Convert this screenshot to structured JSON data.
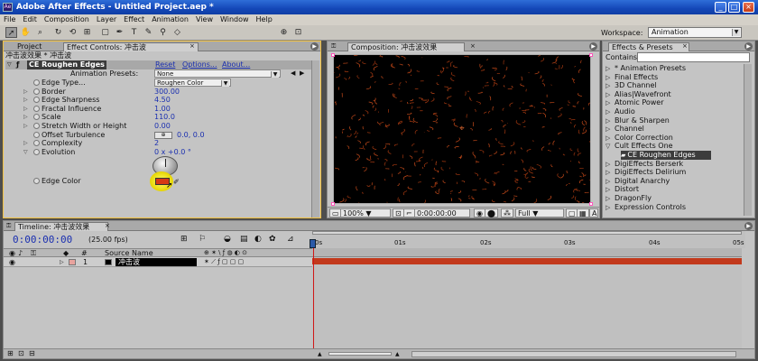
{
  "window": {
    "title": "Adobe After Effects - Untitled Project.aep *",
    "app_icon": "Ae",
    "minimize": "_",
    "maximize": "□",
    "close": "×"
  },
  "menu": [
    "File",
    "Edit",
    "Composition",
    "Layer",
    "Effect",
    "Animation",
    "View",
    "Window",
    "Help"
  ],
  "toolbar": {
    "workspace_label": "Workspace:",
    "workspace_value": "Animation",
    "tools": [
      "selection-arrow",
      "hand",
      "zoom",
      "rotate",
      "camera-orbit",
      "pan-behind",
      "rectangle-mask",
      "pen",
      "type",
      "brush",
      "clone-stamp",
      "eraser",
      "axis-world",
      "axis-view"
    ]
  },
  "left_panel": {
    "tabs": {
      "project": "Project",
      "effect_controls": "Effect Controls: 冲击波"
    },
    "header": "冲击波效果 * 冲击波",
    "effect": {
      "name": "CE Roughen Edges",
      "reset": "Reset",
      "options": "Options...",
      "about": "About..."
    },
    "presets": {
      "label": "Animation Presets:",
      "value": "None"
    },
    "properties": [
      {
        "name": "Edge Type...",
        "value": "Roughen Color",
        "kind": "select"
      },
      {
        "name": "Border",
        "value": "300.00"
      },
      {
        "name": "Edge Sharpness",
        "value": "4.50"
      },
      {
        "name": "Fractal Influence",
        "value": "1.00"
      },
      {
        "name": "Scale",
        "value": "110.0"
      },
      {
        "name": "Stretch Width or Height",
        "value": "0.00"
      },
      {
        "name": "Offset Turbulence",
        "value": "0.0, 0.0"
      },
      {
        "name": "Complexity",
        "value": "2"
      },
      {
        "name": "Evolution",
        "value": "0 x +0.0 °"
      },
      {
        "name": "Edge Color",
        "value": ""
      }
    ]
  },
  "comp_panel": {
    "tab": "Composition: 冲击波效果",
    "zoom": "100%",
    "timecode": "0:00:00:00",
    "resolution": "Full",
    "toggle": "A"
  },
  "fx_panel": {
    "tab": "Effects & Presets",
    "contains_label": "Contains:",
    "contains_value": "",
    "items": [
      {
        "label": "* Animation Presets",
        "open": false
      },
      {
        "label": "Final Effects",
        "open": false
      },
      {
        "label": "3D Channel",
        "open": false
      },
      {
        "label": "Alias|Wavefront",
        "open": false
      },
      {
        "label": "Atomic Power",
        "open": false
      },
      {
        "label": "Audio",
        "open": false
      },
      {
        "label": "Blur & Sharpen",
        "open": false
      },
      {
        "label": "Channel",
        "open": false
      },
      {
        "label": "Color Correction",
        "open": false
      },
      {
        "label": "Cult Effects One",
        "open": true
      },
      {
        "label": "CE Roughen Edges",
        "child": true,
        "selected": true
      },
      {
        "label": "DigiEffects Berserk",
        "open": false
      },
      {
        "label": "DigiEffects Delirium",
        "open": false
      },
      {
        "label": "Digital Anarchy",
        "open": false
      },
      {
        "label": "Distort",
        "open": false
      },
      {
        "label": "DragonFly",
        "open": false
      },
      {
        "label": "Expression Controls",
        "open": false
      }
    ]
  },
  "timeline": {
    "tab": "Timeline: 冲击波效果",
    "timecode": "0:00:00:00",
    "fps": "(25.00 fps)",
    "col_hash": "#",
    "col_source": "Source Name",
    "ruler": [
      "0s",
      "01s",
      "02s",
      "03s",
      "04s",
      "05s"
    ],
    "layer": {
      "index": "1",
      "name": "冲击波"
    }
  }
}
